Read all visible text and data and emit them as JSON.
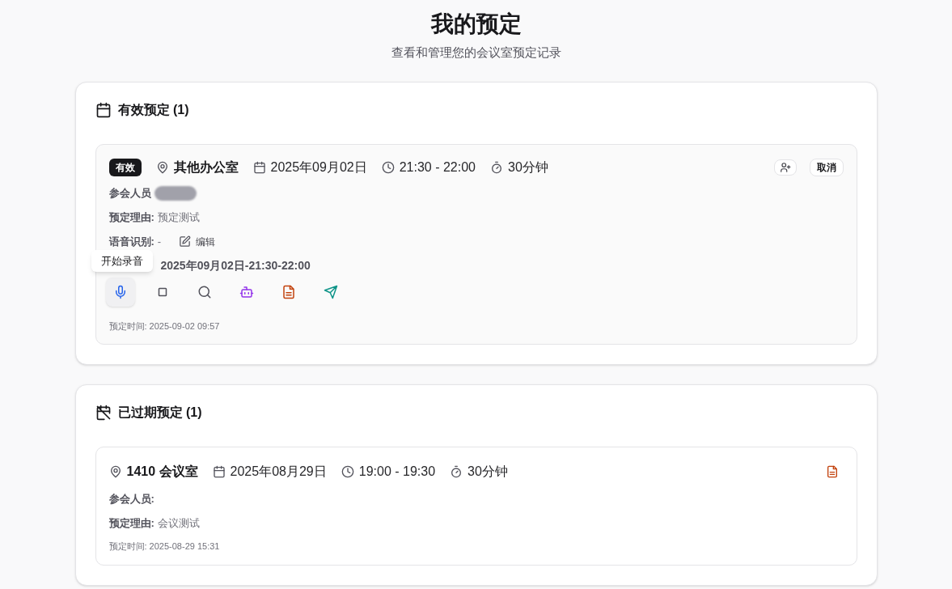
{
  "page": {
    "title": "我的预定",
    "subtitle": "查看和管理您的会议室预定记录"
  },
  "sections": [
    {
      "kind": "active",
      "heading": "有效预定 (1)",
      "bookings": [
        {
          "badge": "有效",
          "room": "其他办公室",
          "date": "2025年09月02日",
          "time": "21:30 - 22:00",
          "duration": "30分钟",
          "attendees_label": "参会人员",
          "attendees_redacted": true,
          "reason_label": "预定理由:",
          "reason": "预定测试",
          "speech_label": "语音识别:",
          "speech": "-",
          "edit": "编辑",
          "meeting_value": "2025年09月02日-21:30-22:00",
          "tooltip": "开始录音",
          "tools": [
            {
              "kind": "mic",
              "selected": true
            },
            {
              "kind": "stop",
              "selected": false
            },
            {
              "kind": "search",
              "selected": false
            },
            {
              "kind": "bot",
              "selected": false
            },
            {
              "kind": "document",
              "selected": false
            },
            {
              "kind": "send",
              "selected": false
            }
          ],
          "booked_at": "预定时间: 2025-09-02 09:57",
          "actions": [
            {
              "kind": "add-person"
            },
            {
              "kind": "text",
              "label": "取消"
            }
          ]
        }
      ]
    },
    {
      "kind": "expired",
      "heading": "已过期预定 (1)",
      "bookings": [
        {
          "room": "1410 会议室",
          "date": "2025年08月29日",
          "time": "19:00 - 19:30",
          "duration": "30分钟",
          "attendees_label": "参会人员:",
          "attendees_redacted": false,
          "reason_label": "预定理由:",
          "reason": "会议测试",
          "booked_at": "预定时间: 2025-08-29 15:31",
          "actions": [
            {
              "kind": "document"
            }
          ]
        }
      ]
    }
  ]
}
